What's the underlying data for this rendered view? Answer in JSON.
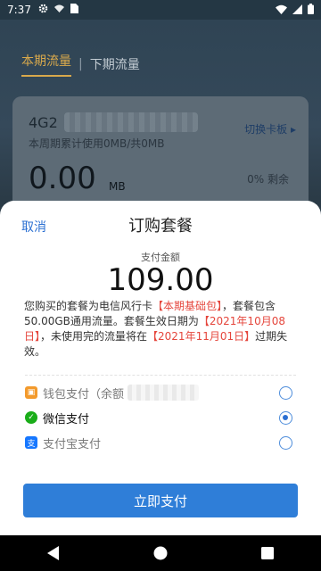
{
  "status_bar": {
    "time": "7:37",
    "icons": [
      "gear-icon",
      "wifi-calling-icon",
      "sim-icon",
      "wifi-icon",
      "signal-icon",
      "battery-icon"
    ]
  },
  "tabs": {
    "current": "本期流量",
    "next": "下期流量"
  },
  "card": {
    "plan_name": "4G2",
    "usage": "本周期累计使用0MB/共0MB",
    "switch_label": "切换卡板",
    "amount": "0.00",
    "unit": "MB",
    "remaining": "0% 剩余"
  },
  "sheet": {
    "cancel": "取消",
    "title": "订购套餐",
    "amount_label": "支付金额",
    "amount": "109.00",
    "desc": {
      "p1": "您购买的套餐为电信风行卡",
      "h1": "【本期基础包】",
      "p2": "，套餐包含50.00GB通用流量。套餐生效日期为",
      "h2": "【2021年10月08日】",
      "p3": "，未使用完的流量将在",
      "h3": "【2021年11月01日】",
      "p4": "过期失效。"
    },
    "payment_methods": [
      {
        "label": "钱包支付（余额",
        "icon": "wallet-icon",
        "selected": false
      },
      {
        "label": "微信支付",
        "icon": "wechat-icon",
        "selected": true
      },
      {
        "label": "支付宝支付",
        "icon": "alipay-icon",
        "selected": false
      }
    ],
    "pay_button": "立即支付"
  },
  "colors": {
    "accent": "#2f7ed8",
    "highlight": "#e5463c",
    "tab_active": "#d9a94c",
    "wechat": "#1aad19",
    "alipay": "#1677ff",
    "wallet": "#f39a2c"
  }
}
